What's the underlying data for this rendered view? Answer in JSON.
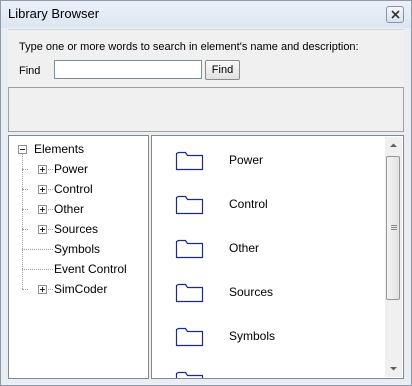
{
  "window": {
    "title": "Library Browser"
  },
  "search": {
    "instruction": "Type one or more words to search in element's name and  description:",
    "find_label": "Find",
    "input_value": "",
    "button_label": "Find"
  },
  "tree": {
    "root": {
      "label": "Elements",
      "state": "expanded"
    },
    "children": [
      {
        "label": "Power",
        "state": "collapsed"
      },
      {
        "label": "Control",
        "state": "collapsed"
      },
      {
        "label": "Other",
        "state": "collapsed"
      },
      {
        "label": "Sources",
        "state": "collapsed"
      },
      {
        "label": "Symbols",
        "state": "leaf"
      },
      {
        "label": "Event Control",
        "state": "leaf"
      },
      {
        "label": "SimCoder",
        "state": "collapsed"
      }
    ]
  },
  "list": {
    "icon": "folder-icon",
    "items": [
      "Power",
      "Control",
      "Other",
      "Sources",
      "Symbols"
    ]
  },
  "colors": {
    "folder_outline": "#1c2a8c",
    "window_frame": "#e9eef5"
  }
}
